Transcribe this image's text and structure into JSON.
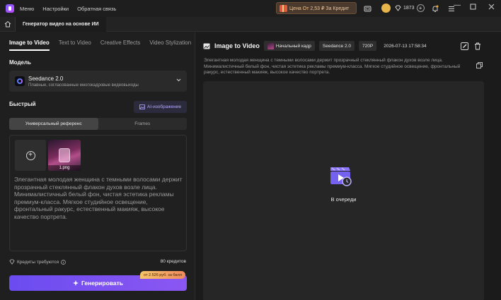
{
  "titlebar": {
    "menu": [
      "Меню",
      "Настройки",
      "Обратная связь"
    ],
    "promo": "Цена От 2,53 ₽ За Кредит",
    "credits": "1873"
  },
  "tabs": {
    "document": "Генератор видео на основе ИИ"
  },
  "left": {
    "modes": [
      "Image to Video",
      "Text to Video",
      "Creative Effects",
      "Video Stylization"
    ],
    "model_section": "Модель",
    "model_name": "Seedance 2.0",
    "model_desc": "Плавные, согласованные многокадровые видеовыходы",
    "quick_section": "Быстрый",
    "ai_image_btn": "AI-изображение",
    "segments": [
      "Универсальный референс",
      "Frames"
    ],
    "image_caption": "1.png",
    "prompt": "Элегантная молодая женщина с темными волосами держит прозрачный стеклянный флакон духов возле лица. Минималистичный белый фон, чистая эстетика рекламы премиум-класса. Мягкое студийное освещение, фронтальный ракурс, естественный макияж, высокое качество портрета.",
    "credits_label": "Кредиты требуются",
    "credits_amount": "80 кредитов",
    "generate_label": "Генерировать",
    "price_badge": "от 2.526 руб. за балл"
  },
  "right": {
    "title": "Image to Video",
    "tag_frame": "Начальный кадр",
    "tag_model": "Seedance 2.0",
    "tag_res": "720P",
    "timestamp": "2026-07-13 17:58:34",
    "prompt": "Элегантная молодая женщина с темными волосами держит прозрачный стеклянный флакон духов возле лица. Минималистичный белый фон, чистая эстетика рекламы премиум-класса. Мягкое студийное освещение, фронтальный ракурс, естественный макияж, высокое качество портрета.",
    "status": "В очереди"
  },
  "colors": {
    "accent": "#7b55f1",
    "badge": "#f2a560",
    "background": "#1e1e1e"
  }
}
